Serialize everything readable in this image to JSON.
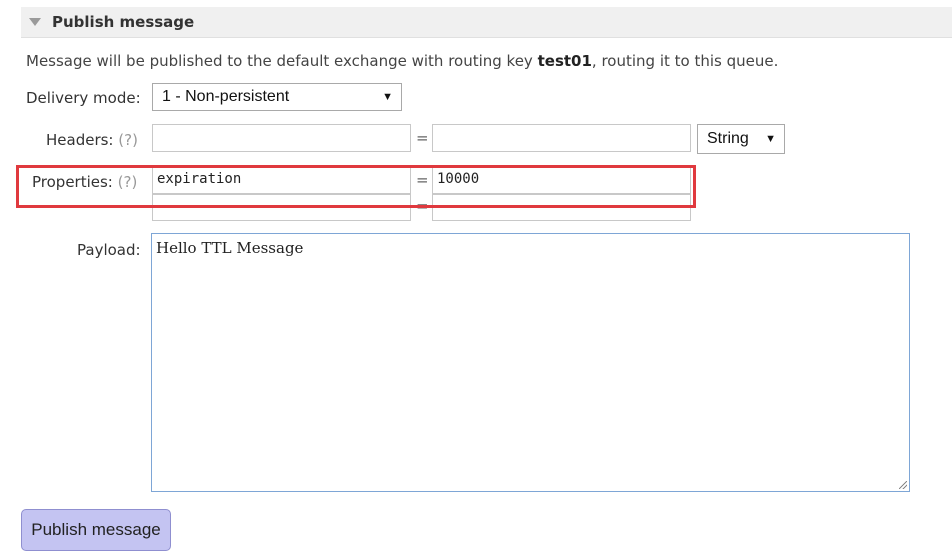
{
  "section": {
    "title": "Publish message"
  },
  "info": {
    "prefix": "Message will be published to the default exchange with routing key ",
    "routing_key": "test01",
    "suffix": ", routing it to this queue."
  },
  "delivery_mode": {
    "label": "Delivery mode:",
    "value": "1 - Non-persistent"
  },
  "headers": {
    "label": "Headers:",
    "help": "(?)",
    "key": "",
    "equals": "=",
    "value": "",
    "type": "String"
  },
  "properties": {
    "label": "Properties:",
    "help": "(?)",
    "rows": [
      {
        "key": "expiration",
        "equals": "=",
        "value": "10000"
      },
      {
        "key": "",
        "equals": "=",
        "value": ""
      }
    ]
  },
  "payload": {
    "label": "Payload:",
    "value": "Hello TTL Message"
  },
  "publish_button": {
    "label": "Publish message"
  },
  "colors": {
    "highlight": "#e0393e",
    "button_bg": "#c4c4f2",
    "payload_border": "#7ea6d6"
  }
}
